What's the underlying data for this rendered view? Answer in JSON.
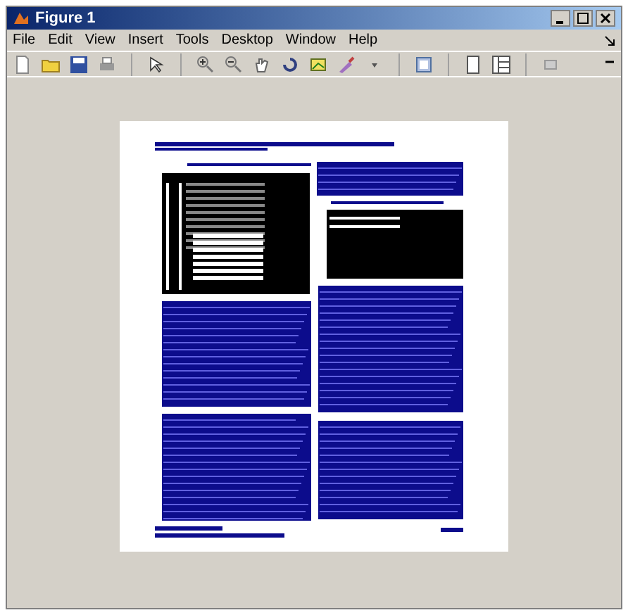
{
  "window": {
    "title": "Figure 1"
  },
  "menus": [
    "File",
    "Edit",
    "View",
    "Insert",
    "Tools",
    "Desktop",
    "Window",
    "Help"
  ]
}
